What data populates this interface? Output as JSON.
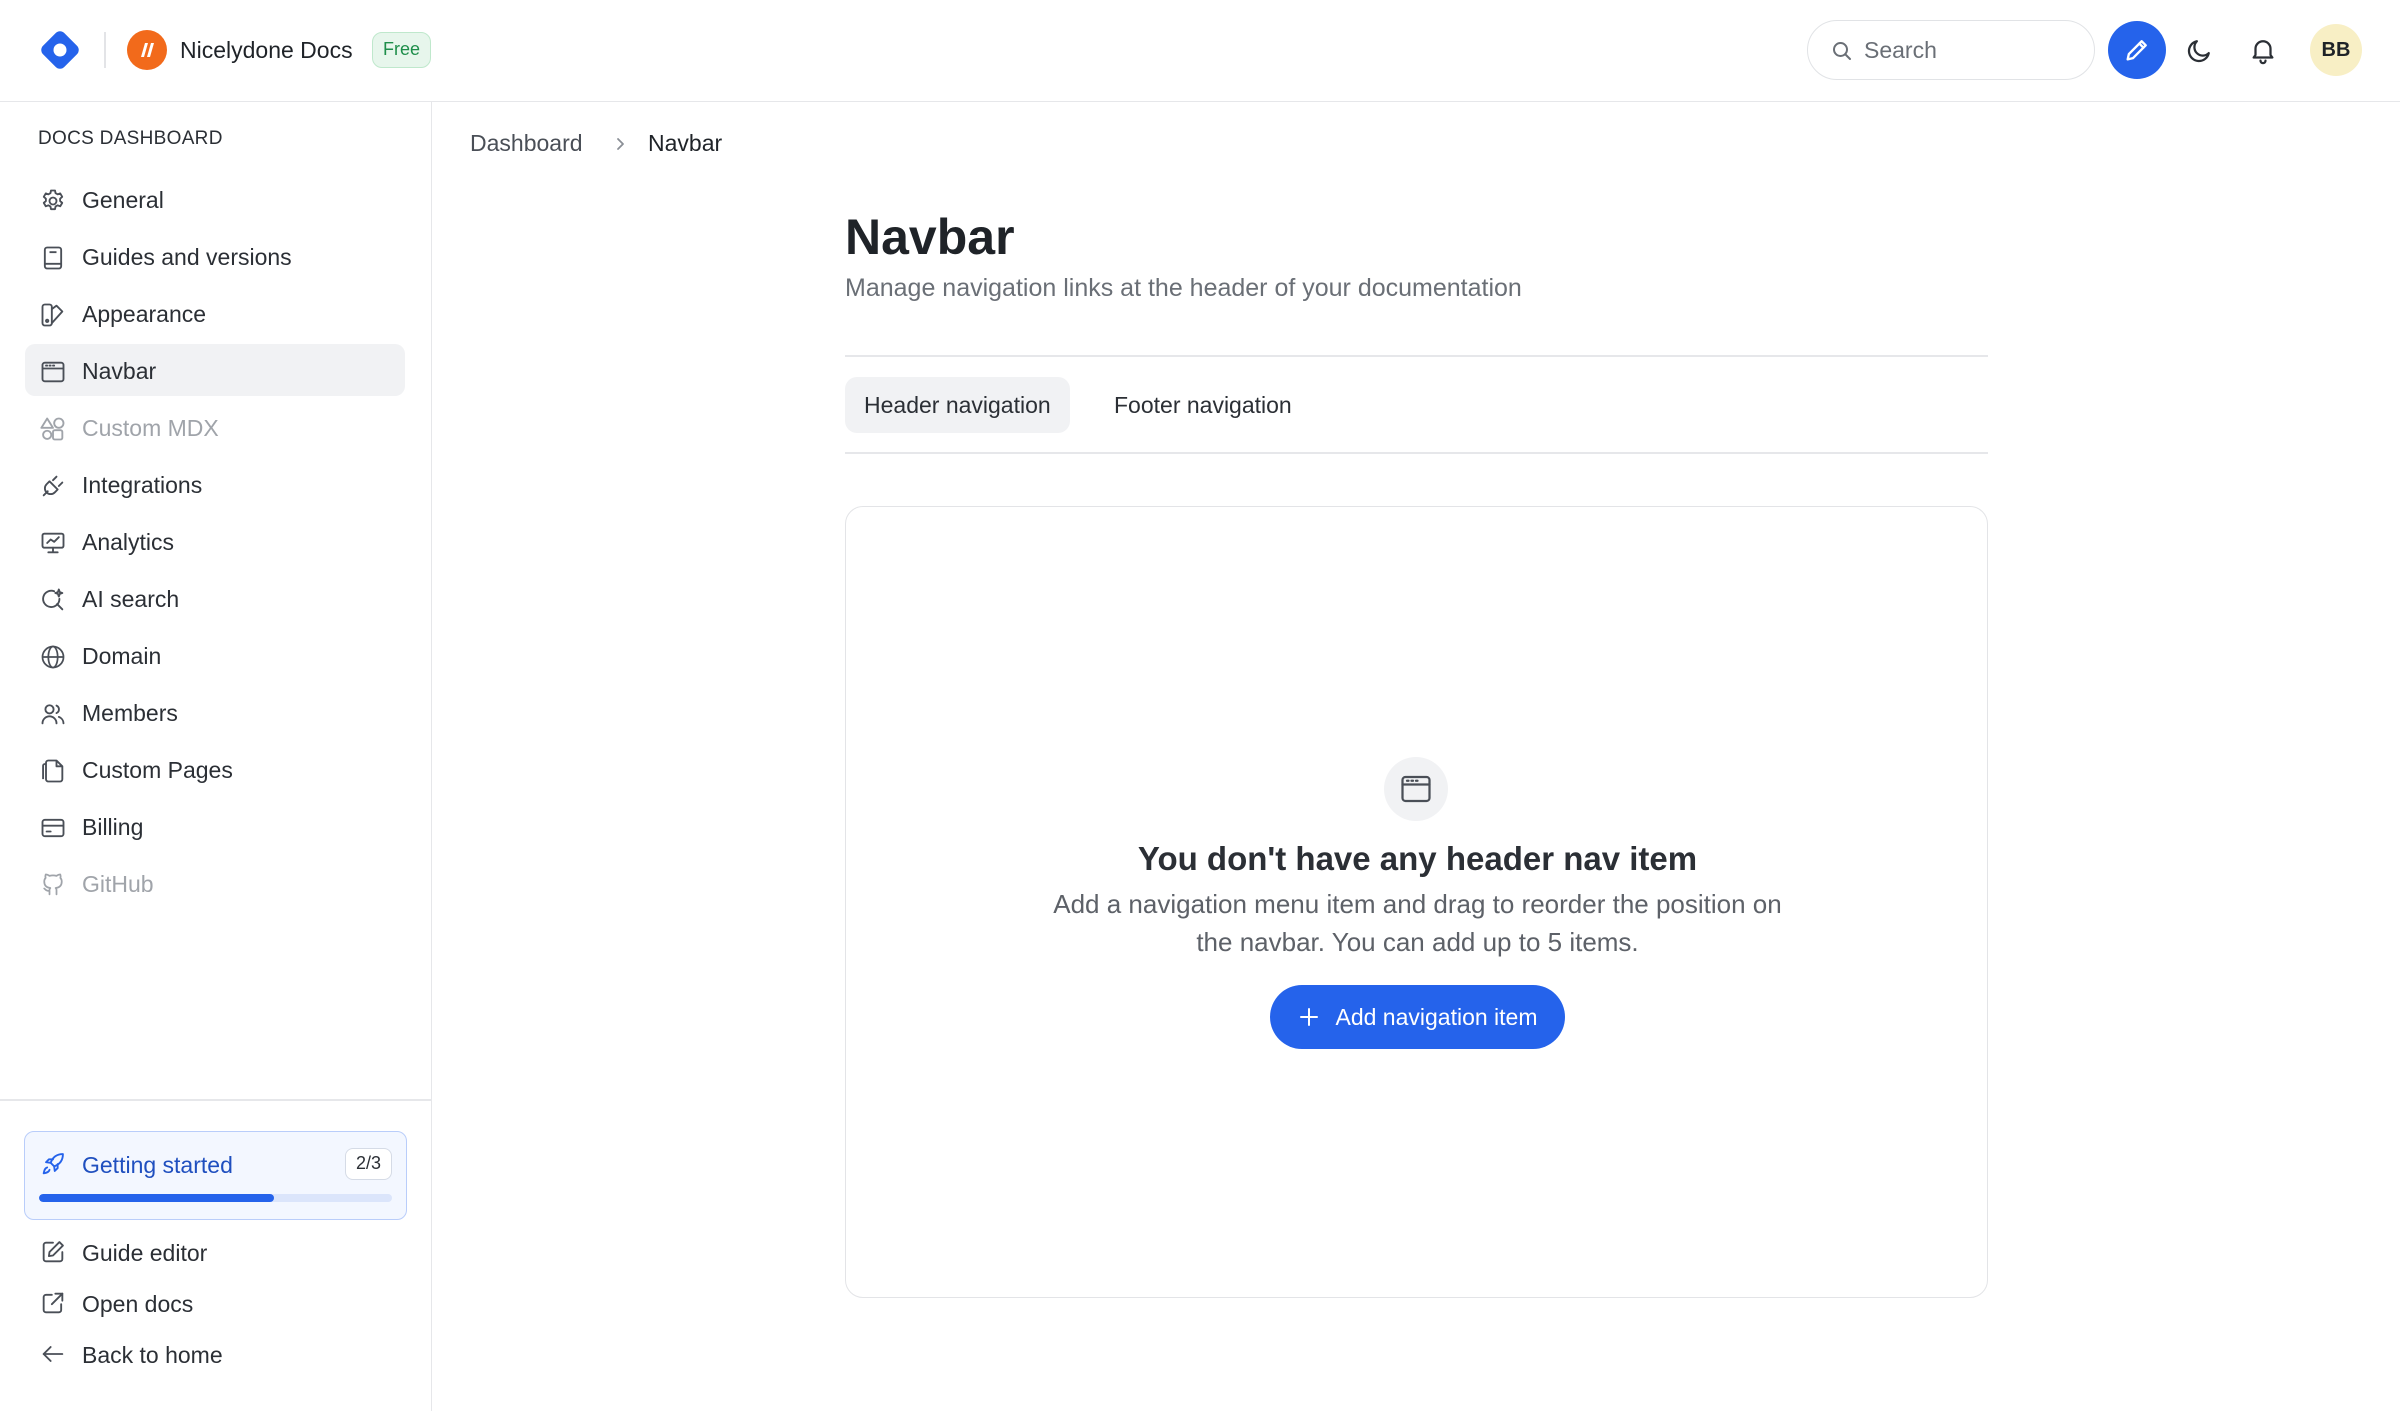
{
  "header": {
    "project_name": "Nicelydone Docs",
    "plan_badge": "Free",
    "search_placeholder": "Search",
    "avatar_initials": "BB"
  },
  "sidebar": {
    "heading": "DOCS DASHBOARD",
    "items": [
      {
        "label": "General",
        "icon": "gear-icon"
      },
      {
        "label": "Guides and versions",
        "icon": "book-icon"
      },
      {
        "label": "Appearance",
        "icon": "palette-icon"
      },
      {
        "label": "Navbar",
        "icon": "browser-icon",
        "active": true
      },
      {
        "label": "Custom MDX",
        "icon": "shapes-icon",
        "disabled": true
      },
      {
        "label": "Integrations",
        "icon": "plug-icon"
      },
      {
        "label": "Analytics",
        "icon": "presentation-chart-icon"
      },
      {
        "label": "AI search",
        "icon": "sparkle-search-icon"
      },
      {
        "label": "Domain",
        "icon": "globe-www-icon"
      },
      {
        "label": "Members",
        "icon": "users-icon"
      },
      {
        "label": "Custom Pages",
        "icon": "files-icon"
      },
      {
        "label": "Billing",
        "icon": "credit-card-icon"
      },
      {
        "label": "GitHub",
        "icon": "github-icon",
        "disabled": true
      }
    ],
    "getting_started": {
      "label": "Getting started",
      "count": "2/3",
      "progress": 0.667
    },
    "footer_items": [
      {
        "label": "Guide editor",
        "icon": "edit-square-icon"
      },
      {
        "label": "Open docs",
        "icon": "external-link-icon"
      },
      {
        "label": "Back to home",
        "icon": "arrow-left-icon"
      }
    ]
  },
  "breadcrumb": {
    "root": "Dashboard",
    "current": "Navbar"
  },
  "page": {
    "title": "Navbar",
    "subtitle": "Manage navigation links at the header of your documentation"
  },
  "tabs": [
    {
      "label": "Header navigation",
      "active": true
    },
    {
      "label": "Footer navigation",
      "active": false
    }
  ],
  "empty_state": {
    "title": "You don't have any header nav item",
    "description": "Add a navigation menu item and drag to reorder the position on the navbar. You can add up to 5 items.",
    "button_label": "Add navigation item"
  },
  "colors": {
    "accent": "#2563eb",
    "project_logo": "#f26a1b",
    "badge_green": "#1e8e4a"
  }
}
